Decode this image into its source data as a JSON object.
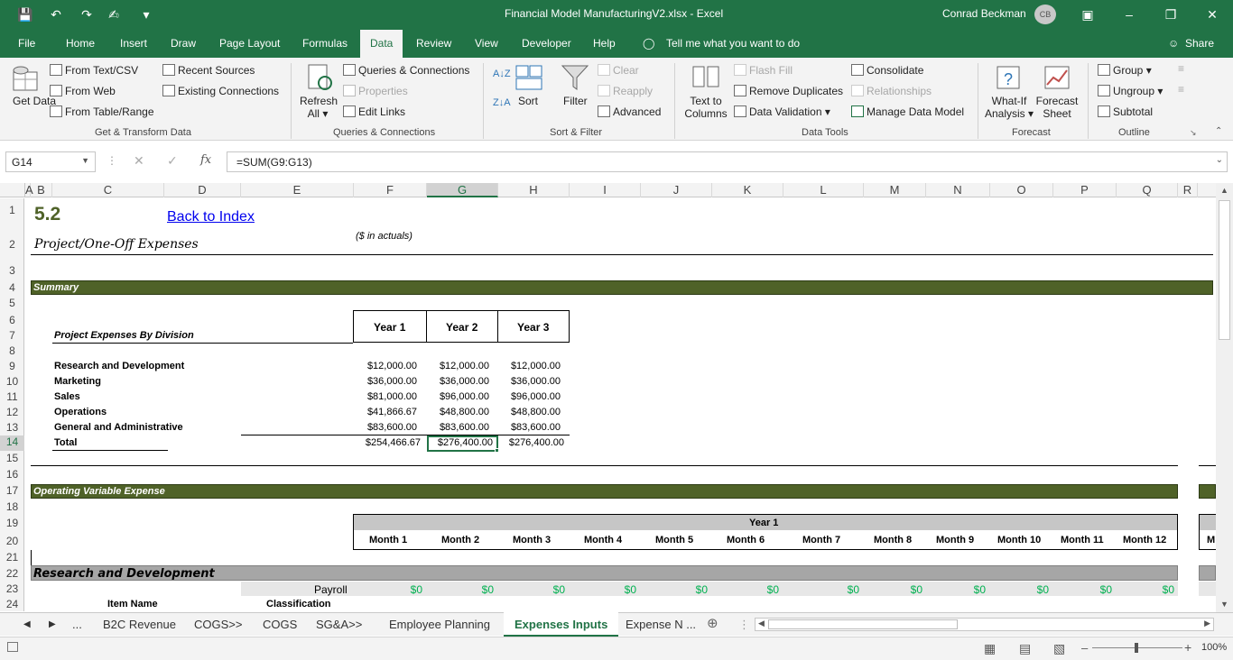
{
  "title_bar": {
    "document_title": "Financial Model ManufacturingV2.xlsx  -  Excel",
    "user_name": "Conrad Beckman",
    "user_initials": "CB"
  },
  "tabs": [
    "File",
    "Home",
    "Insert",
    "Draw",
    "Page Layout",
    "Formulas",
    "Data",
    "Review",
    "View",
    "Developer",
    "Help"
  ],
  "active_tab": "Data",
  "tell_me": "Tell me what you want to do",
  "share": "Share",
  "ribbon": {
    "get_transform": {
      "get_data": "Get Data",
      "from_text_csv": "From Text/CSV",
      "from_web": "From Web",
      "from_table_range": "From Table/Range",
      "recent_sources": "Recent Sources",
      "existing_connections": "Existing Connections",
      "group_label": "Get & Transform Data"
    },
    "queries": {
      "refresh_all_1": "Refresh",
      "refresh_all_2": "All",
      "queries_connections": "Queries & Connections",
      "properties": "Properties",
      "edit_links": "Edit Links",
      "group_label": "Queries & Connections"
    },
    "sort_filter": {
      "sort": "Sort",
      "filter": "Filter",
      "clear": "Clear",
      "reapply": "Reapply",
      "advanced": "Advanced",
      "group_label": "Sort & Filter"
    },
    "data_tools": {
      "text_to_columns_1": "Text to",
      "text_to_columns_2": "Columns",
      "flash_fill": "Flash Fill",
      "remove_duplicates": "Remove Duplicates",
      "data_validation": "Data Validation",
      "consolidate": "Consolidate",
      "relationships": "Relationships",
      "manage_data_model": "Manage Data Model",
      "group_label": "Data Tools"
    },
    "forecast": {
      "what_if_1": "What-If",
      "what_if_2": "Analysis",
      "forecast_sheet_1": "Forecast",
      "forecast_sheet_2": "Sheet",
      "group_label": "Forecast"
    },
    "outline": {
      "group": "Group",
      "ungroup": "Ungroup",
      "subtotal": "Subtotal",
      "group_label": "Outline"
    }
  },
  "formula_bar": {
    "name_box": "G14",
    "formula": "=SUM(G9:G13)"
  },
  "columns": [
    "A",
    "B",
    "C",
    "D",
    "E",
    "F",
    "G",
    "H",
    "I",
    "J",
    "K",
    "L",
    "M",
    "N",
    "O",
    "P",
    "Q",
    "R"
  ],
  "selected_column": "G",
  "rows": [
    "1",
    "2",
    "3",
    "4",
    "5",
    "6",
    "7",
    "8",
    "9",
    "10",
    "11",
    "12",
    "13",
    "14",
    "15",
    "16",
    "17",
    "18",
    "19",
    "20",
    "21",
    "22",
    "23",
    "24"
  ],
  "selected_row": "14",
  "sheet": {
    "section_number": "5.2",
    "back_link": "Back to Index",
    "subtitle": "Project/One-Off Expenses",
    "units_note": "($ in actuals)",
    "summary_label": "Summary",
    "table_caption": "Project Expenses By Division",
    "year_headers": [
      "Year 1",
      "Year 2",
      "Year 3"
    ],
    "divisions": [
      {
        "name": "Research and Development",
        "values": [
          "$12,000.00",
          "$12,000.00",
          "$12,000.00"
        ]
      },
      {
        "name": "Marketing",
        "values": [
          "$36,000.00",
          "$36,000.00",
          "$36,000.00"
        ]
      },
      {
        "name": "Sales",
        "values": [
          "$81,000.00",
          "$96,000.00",
          "$96,000.00"
        ]
      },
      {
        "name": "Operations",
        "values": [
          "$41,866.67",
          "$48,800.00",
          "$48,800.00"
        ]
      },
      {
        "name": "General and Administrative",
        "values": [
          "$83,600.00",
          "$83,600.00",
          "$83,600.00"
        ]
      }
    ],
    "total": {
      "name": "Total",
      "values": [
        "$254,466.67",
        "$276,400.00",
        "$276,400.00"
      ]
    },
    "operating_label": "Operating Variable Expense",
    "year1_label": "Year 1",
    "months": [
      "Month 1",
      "Month 2",
      "Month 3",
      "Month 4",
      "Month 5",
      "Month 6",
      "Month 7",
      "Month 8",
      "Month 9",
      "Month 10",
      "Month 11",
      "Month 12"
    ],
    "rd_label": "Research and Development",
    "payroll_label": "Payroll",
    "payroll_values": [
      "$0",
      "$0",
      "$0",
      "$0",
      "$0",
      "$0",
      "$0",
      "$0",
      "$0",
      "$0",
      "$0",
      "$0"
    ],
    "item_name": "Item Name",
    "classification": "Classification"
  },
  "sheet_tabs": [
    "...",
    "B2C Revenue",
    "COGS>>",
    "COGS",
    "SG&A>>",
    "Employee Planning",
    "Expenses Inputs",
    "Expense N ..."
  ],
  "active_sheet": "Expenses Inputs",
  "zoom": "100%"
}
